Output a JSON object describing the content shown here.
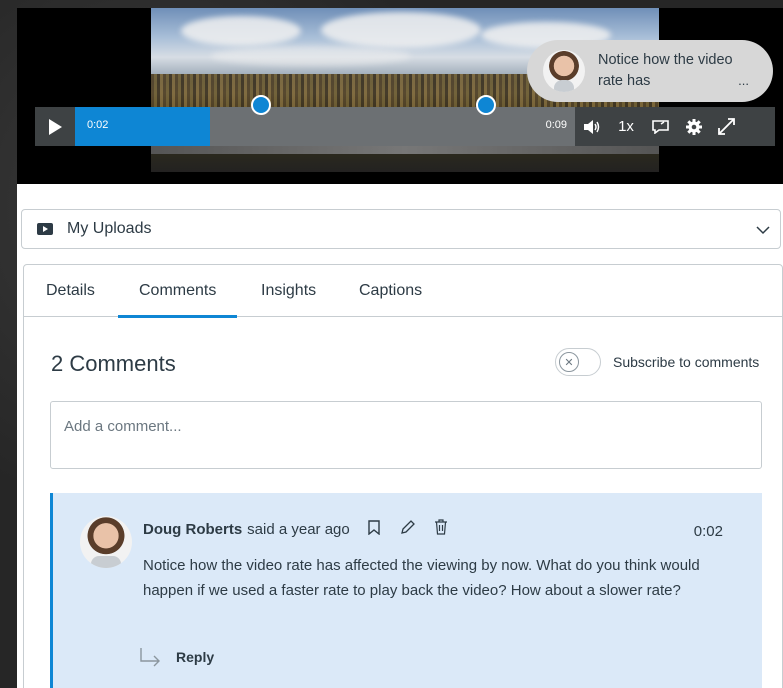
{
  "video": {
    "current_time": "0:02",
    "end_time": "0:09",
    "speed": "1x",
    "progress_fraction": 0.27,
    "icons": [
      "play-icon",
      "volume-icon",
      "caption-icon",
      "settings-icon",
      "fullscreen-icon"
    ]
  },
  "bubble": {
    "text": "Notice how the video rate has",
    "more": "..."
  },
  "uploads": {
    "label": "My Uploads"
  },
  "tabs": [
    {
      "label": "Details"
    },
    {
      "label": "Comments",
      "active": true
    },
    {
      "label": "Insights"
    },
    {
      "label": "Captions"
    }
  ],
  "comments": {
    "title": "2 Comments",
    "subscribe_label": "Subscribe to comments",
    "input_placeholder": "Add a comment..."
  },
  "comment": {
    "author": "Doug Roberts",
    "said": "said a year ago",
    "time": "0:02",
    "body": "Notice how the video rate has affected the viewing by now. What do you think would happen if we used a faster rate to play back the video? How about a slower rate?",
    "reply_label": "Reply"
  },
  "colors": {
    "accent": "#0e86d4",
    "comment_bg": "#dbe9f8",
    "control_bar": "#3e4244"
  }
}
